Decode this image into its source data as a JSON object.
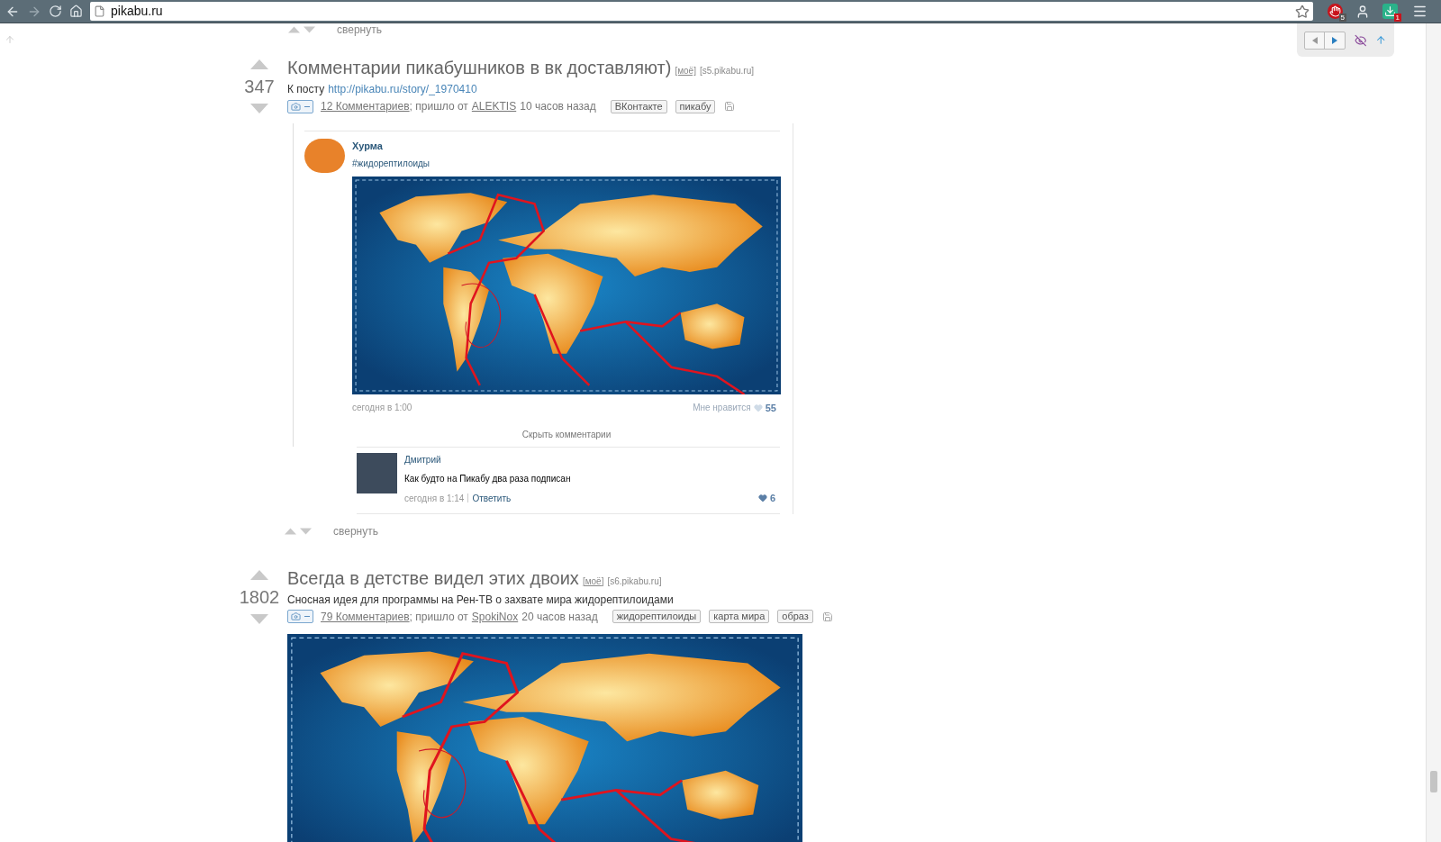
{
  "browser": {
    "url": "pikabu.ru",
    "extension_badges": [
      "5",
      "1"
    ]
  },
  "prev_post": {
    "collapse": "свернуть"
  },
  "posts": [
    {
      "rating": "347",
      "title": "Комментарии пикабушников в вк доставляют)",
      "moe": "[моё]",
      "source": "[s5.pikabu.ru]",
      "description": {
        "text": "К посту",
        "link": "http://pikabu.ru/story/_1970410"
      },
      "media_expanded": true,
      "comments": "12 Комментариев",
      "from_text": "; пришло от",
      "author": "ALEKTIS",
      "time": "10 часов назад",
      "tags": [
        "ВКонтакте",
        "пикабу"
      ],
      "embed": {
        "author": "Хурма",
        "text": "#жидорептилоиды",
        "date": "сегодня в 1:00",
        "likes_label": "Мне нравится",
        "likes": "55",
        "hide_comments": "Скрыть комментарии",
        "comment": {
          "author": "Дмитрий",
          "text": "Как будто на Пикабу два раза подписан",
          "date": "сегодня в 1:14",
          "reply": "Ответить",
          "likes": "6"
        }
      },
      "collapse": "свернуть"
    },
    {
      "rating": "1802",
      "title": "Всегда в детстве видел этих двоих",
      "moe": "[моё]",
      "source": "[s6.pikabu.ru]",
      "description": {
        "text": "Сносная идея для программы на Рен-ТВ о захвате мира жидорептилоидами"
      },
      "media_expanded": true,
      "comments": "79 Комментариев",
      "from_text": "; пришло от",
      "author": "SpokiNox",
      "time": "20 часов назад",
      "tags": [
        "жидорептилоиды",
        "карта мира",
        "образ"
      ]
    }
  ]
}
